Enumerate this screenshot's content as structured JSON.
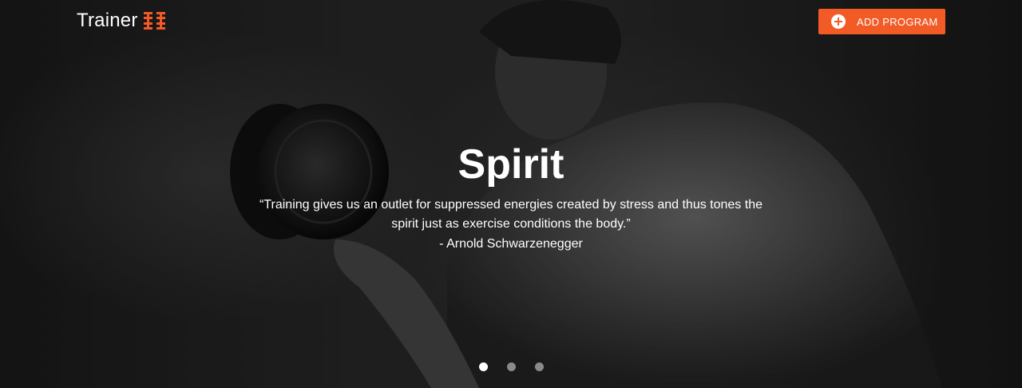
{
  "brand": {
    "name": "Trainer",
    "icon": "dumbbell-icon",
    "accent": "#f25a26"
  },
  "header": {
    "add_program_label": "ADD PROGRAM",
    "add_icon": "plus-circle-icon"
  },
  "slide": {
    "title": "Spirit",
    "quote": "“Training gives us an outlet for suppressed energies created by stress and thus tones the spirit just as exercise conditions the body.”",
    "author": "- Arnold Schwarzenegger"
  },
  "carousel": {
    "total": 3,
    "active": 1
  }
}
